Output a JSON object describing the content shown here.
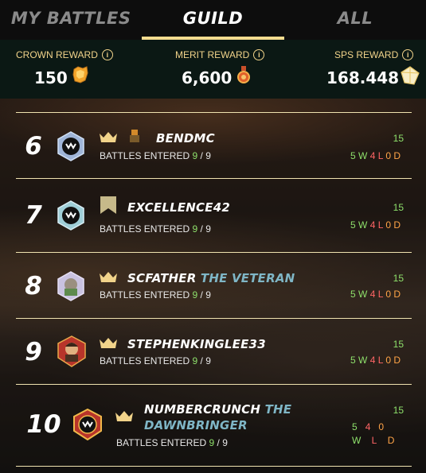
{
  "tabs": [
    {
      "label": "MY BATTLES",
      "active": false
    },
    {
      "label": "GUILD",
      "active": true
    },
    {
      "label": "ALL",
      "active": false
    }
  ],
  "rewards": {
    "crown": {
      "label": "CROWN REWARD",
      "value": "150"
    },
    "merit": {
      "label": "MERIT REWARD",
      "value": "6,600"
    },
    "sps": {
      "label": "SPS REWARD",
      "value": "168.448"
    }
  },
  "battles_label": "BATTLES ENTERED",
  "rows": [
    {
      "rank": "6",
      "name": "BENDMC",
      "title": "",
      "entered": "9",
      "total": "9",
      "score": "15",
      "w": "5",
      "w_label": "W",
      "l": "4",
      "l_label": "L",
      "d": "0",
      "d_label": "D",
      "marker": "crown"
    },
    {
      "rank": "7",
      "name": "EXCELLENCE42",
      "title": "",
      "entered": "9",
      "total": "9",
      "score": "15",
      "w": "5",
      "w_label": "W",
      "l": "4",
      "l_label": "L",
      "d": "0",
      "d_label": "D",
      "marker": "banner"
    },
    {
      "rank": "8",
      "name": "SCFATHER",
      "title": "THE VETERAN",
      "entered": "9",
      "total": "9",
      "score": "15",
      "w": "5",
      "w_label": "W",
      "l": "4",
      "l_label": "L",
      "d": "0",
      "d_label": "D",
      "marker": "crown"
    },
    {
      "rank": "9",
      "name": "STEPHENKINGLEE33",
      "title": "",
      "entered": "9",
      "total": "9",
      "score": "15",
      "w": "5",
      "w_label": "W",
      "l": "4",
      "l_label": "L",
      "d": "0",
      "d_label": "D",
      "marker": "crown"
    },
    {
      "rank": "10",
      "name": "NUMBERCRUNCH",
      "title": "THE",
      "title2": "DAWNBRINGER",
      "entered": "9",
      "total": "9",
      "score": "15",
      "w": "5",
      "w_label": "W",
      "l": "4",
      "l_label": "L",
      "d": "0",
      "d_label": "D",
      "marker": "crown"
    }
  ],
  "colors": {
    "accent": "#f4dc8f",
    "win": "#8ee06b",
    "loss": "#ff6565",
    "draw": "#ffa447",
    "title": "#7fb6c6"
  }
}
